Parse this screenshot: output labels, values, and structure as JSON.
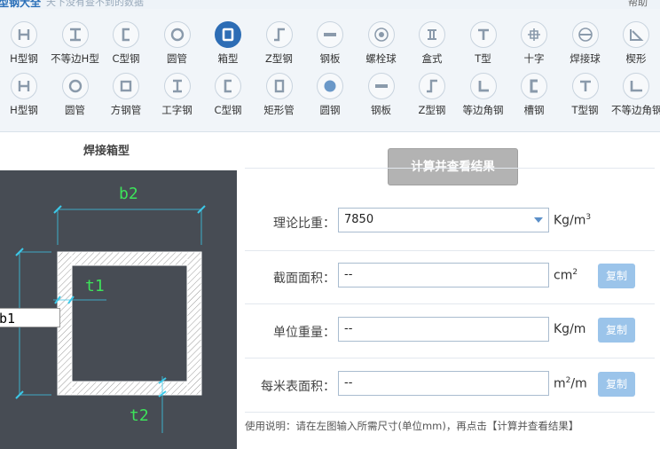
{
  "topbar": {
    "app_name": "型钢大全",
    "slogan": "天下没有查不到的数据",
    "help": "帮助"
  },
  "toolbar": {
    "row1": [
      {
        "label": "H型钢",
        "icon": "h-beam-icon"
      },
      {
        "label": "不等边H型",
        "icon": "unequal-h-beam-icon"
      },
      {
        "label": "C型钢",
        "icon": "c-channel-icon"
      },
      {
        "label": "圆管",
        "icon": "round-tube-icon"
      },
      {
        "label": "箱型",
        "icon": "box-section-icon"
      },
      {
        "label": "Z型钢",
        "icon": "z-section-icon"
      },
      {
        "label": "钢板",
        "icon": "steel-plate-icon"
      },
      {
        "label": "螺栓球",
        "icon": "bolt-ball-icon"
      },
      {
        "label": "盒式",
        "icon": "box-type-icon"
      },
      {
        "label": "T型",
        "icon": "t-section-icon"
      },
      {
        "label": "十字",
        "icon": "cross-section-icon"
      },
      {
        "label": "焊接球",
        "icon": "welded-ball-icon"
      },
      {
        "label": "楔形",
        "icon": "wedge-icon"
      }
    ],
    "row2": [
      {
        "label": "H型钢",
        "icon": "h-beam-icon"
      },
      {
        "label": "圆管",
        "icon": "round-tube-icon"
      },
      {
        "label": "方钢管",
        "icon": "square-tube-icon"
      },
      {
        "label": "工字钢",
        "icon": "i-beam-icon"
      },
      {
        "label": "C型钢",
        "icon": "c-channel-icon"
      },
      {
        "label": "矩形管",
        "icon": "rect-tube-icon"
      },
      {
        "label": "圆钢",
        "icon": "round-bar-icon"
      },
      {
        "label": "钢板",
        "icon": "steel-plate-icon"
      },
      {
        "label": "Z型钢",
        "icon": "z-section-icon"
      },
      {
        "label": "等边角钢",
        "icon": "equal-angle-icon"
      },
      {
        "label": "槽钢",
        "icon": "channel-icon"
      },
      {
        "label": "T型钢",
        "icon": "t-beam-icon"
      },
      {
        "label": "不等边角钢",
        "icon": "unequal-angle-icon"
      }
    ],
    "active_index": 4
  },
  "left": {
    "title": "焊接箱型",
    "labels": {
      "b2": "b2",
      "t1": "t1",
      "t2": "t2"
    },
    "b1_input": "b1"
  },
  "form": {
    "calc_button": "计算并查看结果",
    "density": {
      "label": "理论比重：",
      "value": "7850",
      "unit": "Kg/m",
      "unit_sup": "3"
    },
    "area": {
      "label": "截面面积：",
      "value": "--",
      "unit": "cm",
      "unit_sup": "2",
      "copy": "复制"
    },
    "weight": {
      "label": "单位重量：",
      "value": "--",
      "unit": "Kg/m",
      "copy": "复制"
    },
    "surface": {
      "label": "每米表面积：",
      "value": "--",
      "unit_pre": "m",
      "unit_sup": "2",
      "unit_post": "/m",
      "copy": "复制"
    },
    "note": "使用说明：请在左图输入所需尺寸(单位mm)，再点击【计算并查看结果】"
  },
  "colors": {
    "accent": "#2d6db5",
    "dim_line": "#3cc8e8",
    "dim_text": "#3de35a",
    "copy_btn": "#9bc4ea"
  }
}
